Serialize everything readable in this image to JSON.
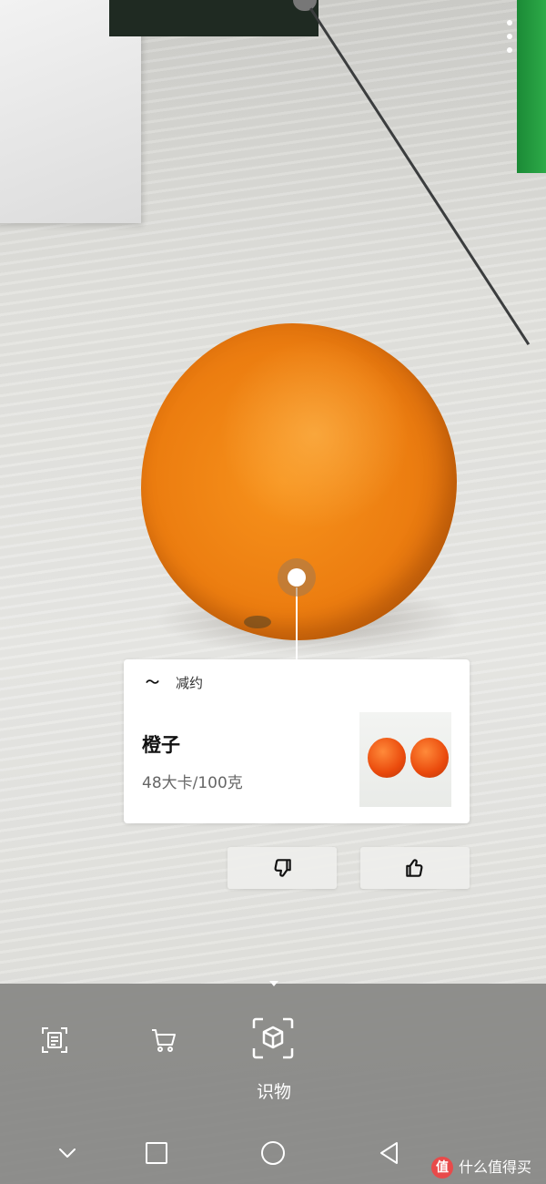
{
  "card": {
    "brand_name": "减约",
    "food_name": "橙子",
    "calories": "48大卡/100克"
  },
  "modes": {
    "active_label": "识物",
    "items": [
      "scan-text-icon",
      "shopping-cart-icon",
      "object-recognition-icon"
    ]
  },
  "feedback": {
    "icons": [
      "thumbs-down-icon",
      "thumbs-up-icon"
    ]
  },
  "watermark": {
    "badge": "值",
    "text": "什么值得买"
  },
  "colors": {
    "orange": "#ec7d10",
    "panel": "#878784",
    "watermark_badge": "#e84a4a"
  }
}
